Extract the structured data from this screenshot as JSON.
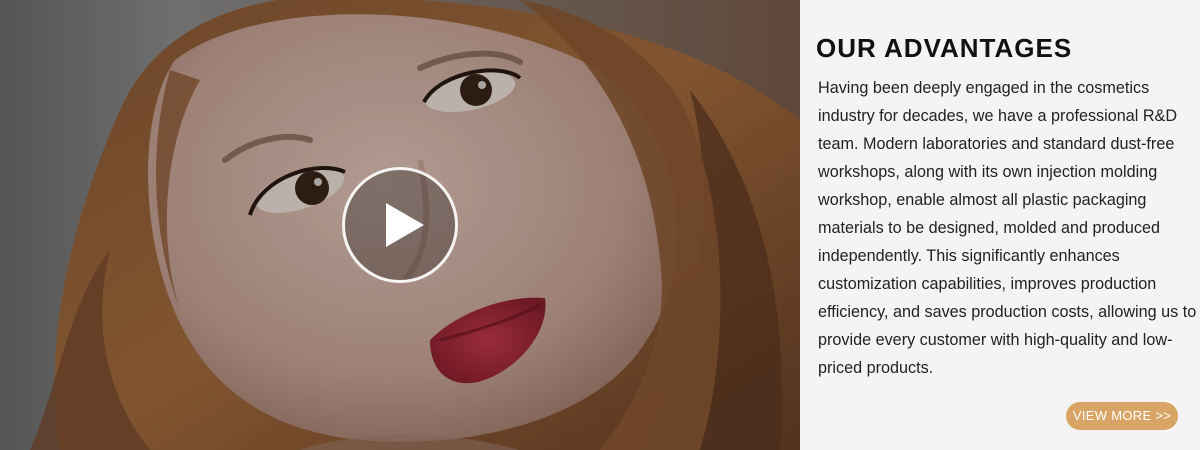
{
  "section": {
    "title": "OUR ADVANTAGES",
    "body": "Having been deeply engaged in the cosmetics industry for decades, we have a professional R&D team. Modern laboratories and standard dust-free workshops, along with its own injection molding workshop, enable almost all plastic packaging materials to be designed, molded and produced independently. This significantly enhances customization capabilities, improves production efficiency, and saves production costs, allowing us to provide every customer with high-quality and low-priced products.",
    "cta_label": "VIEW MORE >>"
  },
  "video": {
    "play_icon": "play-icon"
  },
  "colors": {
    "accent": "#d9a566",
    "panel_background": "#f4f4f4",
    "heading": "#111111"
  }
}
